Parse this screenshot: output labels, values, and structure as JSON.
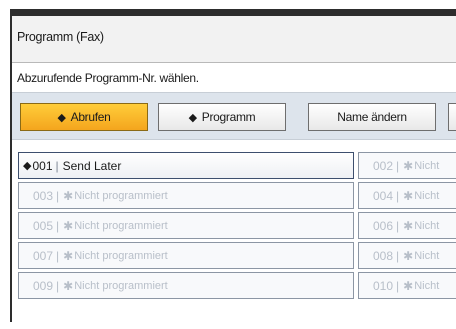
{
  "window": {
    "title": "Programm (Fax)"
  },
  "instruction": "Abzurufende Programm-Nr. wählen.",
  "tabs": [
    {
      "label": "Abrufen",
      "icon": "◆",
      "active": true
    },
    {
      "label": "Programm",
      "icon": "◆",
      "active": false
    },
    {
      "label": "Name ändern",
      "icon": "",
      "active": false
    }
  ],
  "programs": [
    {
      "num": "001",
      "label": "Send Later",
      "programmed": true
    },
    {
      "num": "002",
      "label": "Nicht",
      "programmed": false
    },
    {
      "num": "003",
      "label": "Nicht programmiert",
      "programmed": false
    },
    {
      "num": "004",
      "label": "Nicht",
      "programmed": false
    },
    {
      "num": "005",
      "label": "Nicht programmiert",
      "programmed": false
    },
    {
      "num": "006",
      "label": "Nicht",
      "programmed": false
    },
    {
      "num": "007",
      "label": "Nicht programmiert",
      "programmed": false
    },
    {
      "num": "008",
      "label": "Nicht",
      "programmed": false
    },
    {
      "num": "009",
      "label": "Nicht programmiert",
      "programmed": false
    },
    {
      "num": "010",
      "label": "Nicht",
      "programmed": false
    }
  ],
  "colors": {
    "active_tab": "#f6b428",
    "bar": "#dde4ec"
  }
}
